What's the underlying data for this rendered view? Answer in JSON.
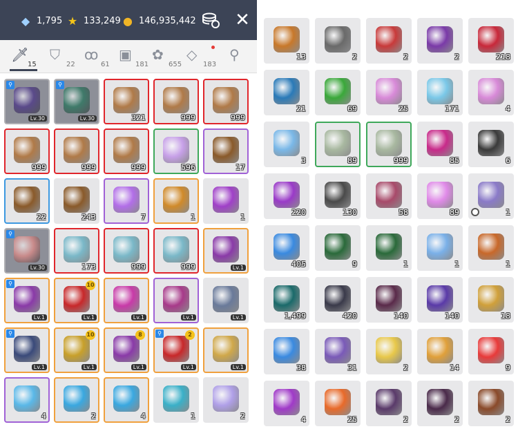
{
  "header": {
    "diamonds": "1,795",
    "stars": "133,249",
    "mesos": "146,935,442",
    "sort_icon": "coin-stack-icon",
    "close_icon": "close-icon"
  },
  "tabs": [
    {
      "name": "weapon",
      "icon": "sword-icon",
      "count": "15",
      "active": true
    },
    {
      "name": "armor",
      "icon": "shield-icon",
      "count": "22",
      "active": false
    },
    {
      "name": "accessory",
      "icon": "necklace-icon",
      "count": "61",
      "active": false
    },
    {
      "name": "consumable",
      "icon": "bag-icon",
      "count": "181",
      "active": false
    },
    {
      "name": "misc",
      "icon": "fish-icon",
      "count": "655",
      "active": false
    },
    {
      "name": "cash",
      "icon": "gem-icon",
      "count": "183",
      "active": false,
      "alert": true
    },
    {
      "name": "search",
      "icon": "search-icon",
      "count": "",
      "active": false
    }
  ],
  "left_items": [
    {
      "border": "grey",
      "disabled": true,
      "mag": true,
      "label": "Lv.30",
      "color": "#5a4a8a"
    },
    {
      "border": "grey",
      "disabled": true,
      "mag": true,
      "label": "Lv.30",
      "color": "#3f7a6a"
    },
    {
      "border": "red",
      "count": "321",
      "color": "#b07a48"
    },
    {
      "border": "red",
      "count": "999",
      "color": "#b07a48"
    },
    {
      "border": "red",
      "count": "999",
      "color": "#b07a48"
    },
    {
      "border": "red",
      "count": "999",
      "color": "#b07a48"
    },
    {
      "border": "red",
      "count": "999",
      "color": "#b07a48"
    },
    {
      "border": "red",
      "count": "999",
      "color": "#b07a48"
    },
    {
      "border": "green",
      "count": "596",
      "color": "#c7a0e8"
    },
    {
      "border": "purple",
      "count": "17",
      "color": "#8a5a2a"
    },
    {
      "border": "blue",
      "count": "22",
      "color": "#8a5a2a"
    },
    {
      "border": "none",
      "count": "243",
      "color": "#8a5a2a"
    },
    {
      "border": "purple",
      "count": "7",
      "color": "#b26ee8"
    },
    {
      "border": "orange",
      "count": "1",
      "color": "#d08a2a"
    },
    {
      "border": "none",
      "count": "1",
      "color": "#a040c8"
    },
    {
      "border": "grey",
      "disabled": true,
      "mag": true,
      "label": "Lv.30",
      "color": "#c88a8a"
    },
    {
      "border": "red",
      "count": "173",
      "color": "#7ab8c8"
    },
    {
      "border": "red",
      "count": "999",
      "color": "#7ab8c8"
    },
    {
      "border": "red",
      "count": "999",
      "color": "#7ab8c8"
    },
    {
      "border": "orange",
      "label": "Lv.1",
      "color": "#8a3aa8"
    },
    {
      "border": "orange",
      "mag": true,
      "label": "Lv.1",
      "color": "#8a3aa8"
    },
    {
      "border": "orange",
      "star": "10",
      "label": "Lv.1",
      "color": "#c8282a"
    },
    {
      "border": "orange",
      "label": "Lv.1",
      "color": "#c83aa8"
    },
    {
      "border": "purple",
      "label": "Lv.1",
      "color": "#a83a8a"
    },
    {
      "border": "none",
      "label": "Lv.1",
      "color": "#6a7a9a"
    },
    {
      "border": "orange",
      "mag": true,
      "label": "Lv.1",
      "color": "#3a4a7a"
    },
    {
      "border": "orange",
      "star": "10",
      "label": "Lv.1",
      "color": "#c8a02a"
    },
    {
      "border": "orange",
      "star": "8",
      "label": "Lv.1",
      "color": "#8a3aa8"
    },
    {
      "border": "orange",
      "mag": true,
      "star": "2",
      "label": "Lv.1",
      "color": "#c8282a"
    },
    {
      "border": "orange",
      "label": "Lv.1",
      "color": "#d0a84a"
    },
    {
      "border": "purple",
      "count": "4",
      "color": "#5ab8e8"
    },
    {
      "border": "orange",
      "count": "2",
      "color": "#3aa8e0"
    },
    {
      "border": "orange",
      "count": "4",
      "color": "#3aa8e0"
    },
    {
      "border": "none",
      "count": "1",
      "color": "#3ab0c8"
    },
    {
      "border": "none",
      "count": "2",
      "color": "#b0a0e8"
    }
  ],
  "right_items": [
    {
      "count": "13",
      "color": "#c8782a"
    },
    {
      "count": "2",
      "color": "#6a6a6a"
    },
    {
      "count": "2",
      "color": "#c83a3a"
    },
    {
      "count": "2",
      "color": "#7a3aa8"
    },
    {
      "count": "218",
      "color": "#c8283a"
    },
    {
      "count": "21",
      "color": "#2a7ab8"
    },
    {
      "count": "69",
      "color": "#3aa83a"
    },
    {
      "count": "25",
      "color": "#d88ad8"
    },
    {
      "count": "171",
      "color": "#7ac8e8"
    },
    {
      "count": "4",
      "color": "#d88ad8"
    },
    {
      "count": "3",
      "color": "#7ab8e8"
    },
    {
      "border": "green",
      "count": "89",
      "color": "#a8b8a0"
    },
    {
      "border": "green",
      "count": "999",
      "color": "#a8b8a0"
    },
    {
      "count": "85",
      "color": "#c82a8a"
    },
    {
      "count": "6",
      "color": "#3a3a3a"
    },
    {
      "count": "220",
      "color": "#9a3ac8"
    },
    {
      "count": "130",
      "color": "#4a4a4a"
    },
    {
      "count": "58",
      "color": "#a84a6a"
    },
    {
      "count": "89",
      "color": "#e08ae8"
    },
    {
      "count": "1",
      "clock": true,
      "color": "#8a7ac8"
    },
    {
      "count": "405",
      "color": "#3a8ae0"
    },
    {
      "count": "9",
      "color": "#2a6a3a"
    },
    {
      "count": "1",
      "color": "#2a6a3a"
    },
    {
      "count": "1",
      "color": "#7ab0e8"
    },
    {
      "count": "1",
      "color": "#c8682a"
    },
    {
      "count": "1,499",
      "color": "#1a6a6a"
    },
    {
      "count": "420",
      "color": "#3a3a4a"
    },
    {
      "count": "140",
      "color": "#5a2a4a"
    },
    {
      "count": "140",
      "color": "#5a3aa8"
    },
    {
      "count": "18",
      "color": "#d0a03a"
    },
    {
      "count": "38",
      "color": "#3a8ae0"
    },
    {
      "count": "31",
      "color": "#7a5ab8"
    },
    {
      "count": "2",
      "color": "#e8c84a"
    },
    {
      "count": "14",
      "color": "#e0a03a"
    },
    {
      "count": "9",
      "color": "#e83a3a"
    },
    {
      "count": "4",
      "color": "#a03ac8"
    },
    {
      "count": "25",
      "color": "#e86a2a"
    },
    {
      "count": "2",
      "color": "#5a3a6a"
    },
    {
      "count": "2",
      "color": "#4a2a4a"
    },
    {
      "count": "2",
      "color": "#8a4a2a"
    }
  ]
}
